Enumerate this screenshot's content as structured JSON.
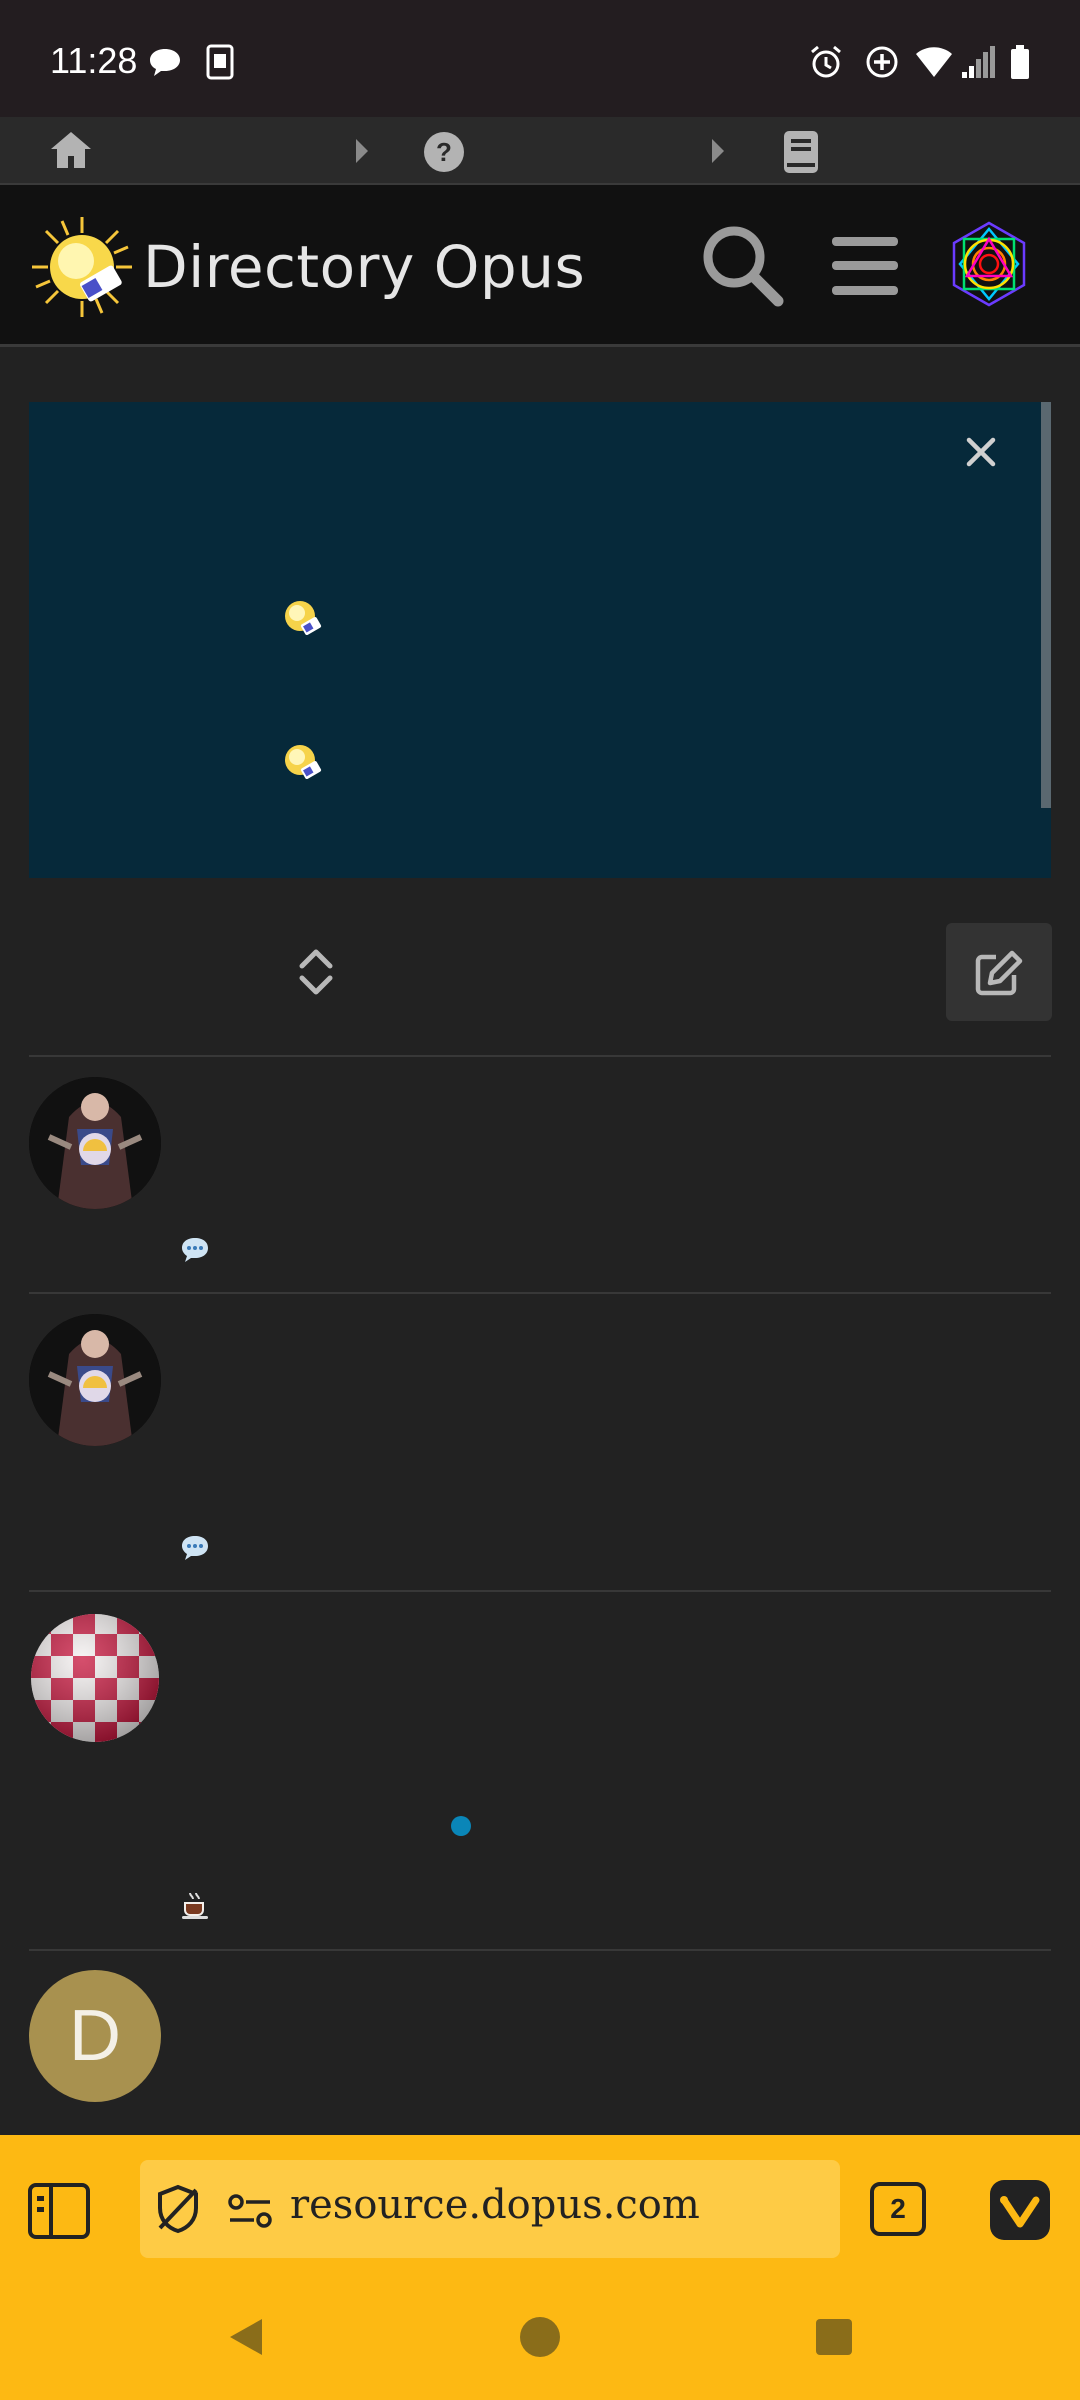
{
  "status_bar": {
    "time": "11:28",
    "left_icons": [
      "chat-bubble-icon",
      "sim-card-icon"
    ],
    "right_icons": [
      "alarm-icon",
      "data-saver-icon",
      "wifi-icon",
      "signal-icon",
      "battery-icon"
    ]
  },
  "breadcrumb": {
    "items": [
      "home-icon",
      "help-icon",
      "book-icon"
    ]
  },
  "header": {
    "title": "Directory Opus"
  },
  "topics": [
    {
      "avatar": "superman-avatar",
      "meta_icon": "speech-bubble-icon"
    },
    {
      "avatar": "superman-avatar",
      "meta_icon": "speech-bubble-icon"
    },
    {
      "avatar": "boing-ball-avatar",
      "meta_icon": "coffee-icon",
      "has_unread_dot": true
    },
    {
      "avatar": "letter-avatar",
      "letter": "D"
    }
  ],
  "browser": {
    "url": "resource.dopus.com",
    "tab_count": "2"
  },
  "colors": {
    "background": "#222222",
    "banner": "#06293a",
    "browser_bar": "#fdb913",
    "unread_dot": "#0a86b8",
    "avatar_d": "#a8914f"
  }
}
